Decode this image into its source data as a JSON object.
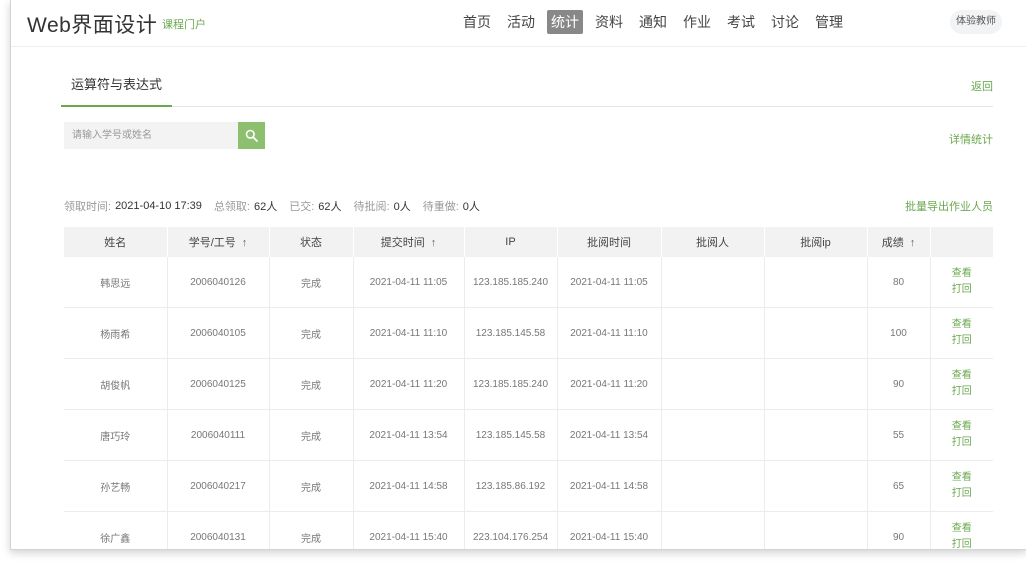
{
  "header": {
    "title": "Web界面设计",
    "subtitle": "课程门户",
    "nav": [
      {
        "label": "首页",
        "active": false
      },
      {
        "label": "活动",
        "active": false
      },
      {
        "label": "统计",
        "active": true
      },
      {
        "label": "资料",
        "active": false
      },
      {
        "label": "通知",
        "active": false
      },
      {
        "label": "作业",
        "active": false
      },
      {
        "label": "考试",
        "active": false
      },
      {
        "label": "讨论",
        "active": false
      },
      {
        "label": "管理",
        "active": false
      }
    ],
    "user_label": "体验教师"
  },
  "page": {
    "tab_title": "运算符与表达式",
    "back_label": "返回",
    "search_placeholder": "请输入学号或姓名",
    "stats_link": "详情统计",
    "export_link": "批量导出作业人员"
  },
  "summary": {
    "deadline_label": "领取时间:",
    "deadline_value": "2021-04-10 17:39",
    "total_label": "总领取:",
    "total_value": "62人",
    "submitted_label": "已交:",
    "submitted_value": "62人",
    "pending_label": "待批阅:",
    "pending_value": "0人",
    "unsubmitted_label": "待重做:",
    "unsubmitted_value": "0人"
  },
  "table": {
    "headers": [
      "姓名",
      "学号/工号",
      "状态",
      "提交时间",
      "IP",
      "批阅时间",
      "批阅人",
      "批阅ip",
      "成绩",
      ""
    ],
    "sortable": [
      false,
      true,
      false,
      true,
      false,
      false,
      false,
      false,
      true,
      false
    ],
    "view_label": "查看",
    "redo_label": "打回",
    "rows": [
      {
        "name": "韩思远",
        "id": "2006040126",
        "status": "完成",
        "submit": "2021-04-11 11:05",
        "ip": "123.185.185.240",
        "review_time": "2021-04-11 11:05",
        "reviewer": "",
        "review_ip": "",
        "score": "80"
      },
      {
        "name": "杨雨希",
        "id": "2006040105",
        "status": "完成",
        "submit": "2021-04-11 11:10",
        "ip": "123.185.145.58",
        "review_time": "2021-04-11 11:10",
        "reviewer": "",
        "review_ip": "",
        "score": "100"
      },
      {
        "name": "胡俊帆",
        "id": "2006040125",
        "status": "完成",
        "submit": "2021-04-11 11:20",
        "ip": "123.185.185.240",
        "review_time": "2021-04-11 11:20",
        "reviewer": "",
        "review_ip": "",
        "score": "90"
      },
      {
        "name": "唐巧玲",
        "id": "2006040111",
        "status": "完成",
        "submit": "2021-04-11 13:54",
        "ip": "123.185.145.58",
        "review_time": "2021-04-11 13:54",
        "reviewer": "",
        "review_ip": "",
        "score": "55"
      },
      {
        "name": "孙艺畅",
        "id": "2006040217",
        "status": "完成",
        "submit": "2021-04-11 14:58",
        "ip": "123.185.86.192",
        "review_time": "2021-04-11 14:58",
        "reviewer": "",
        "review_ip": "",
        "score": "65"
      },
      {
        "name": "徐广鑫",
        "id": "2006040131",
        "status": "完成",
        "submit": "2021-04-11 15:40",
        "ip": "223.104.176.254",
        "review_time": "2021-04-11 15:40",
        "reviewer": "",
        "review_ip": "",
        "score": "90"
      }
    ]
  },
  "colors": {
    "accent": "#6aa84f",
    "active_nav": "#888888"
  }
}
